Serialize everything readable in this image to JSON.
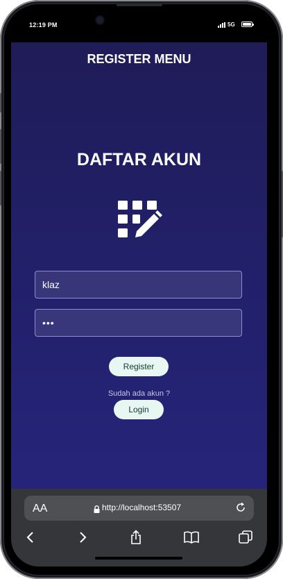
{
  "status": {
    "time": "12:19 PM",
    "network": "5G"
  },
  "app": {
    "menu_title": "REGISTER MENU",
    "heading": "DAFTAR AKUN",
    "username_value": "klaz",
    "password_value": "•••",
    "register_label": "Register",
    "hint": "Sudah ada akun ?",
    "login_label": "Login",
    "icon": "register-grid-pencil-icon"
  },
  "browser": {
    "aa_label": "AA",
    "url": "http://localhost:53507",
    "icons": [
      "lock-icon",
      "reload-icon",
      "back-icon",
      "forward-icon",
      "share-icon",
      "bookmarks-icon",
      "tabs-icon"
    ]
  },
  "colors": {
    "app_top": "#1f1c58",
    "app_bottom": "#25247a",
    "button_bg": "#e8f7f2",
    "button_text": "#0d3b33"
  }
}
